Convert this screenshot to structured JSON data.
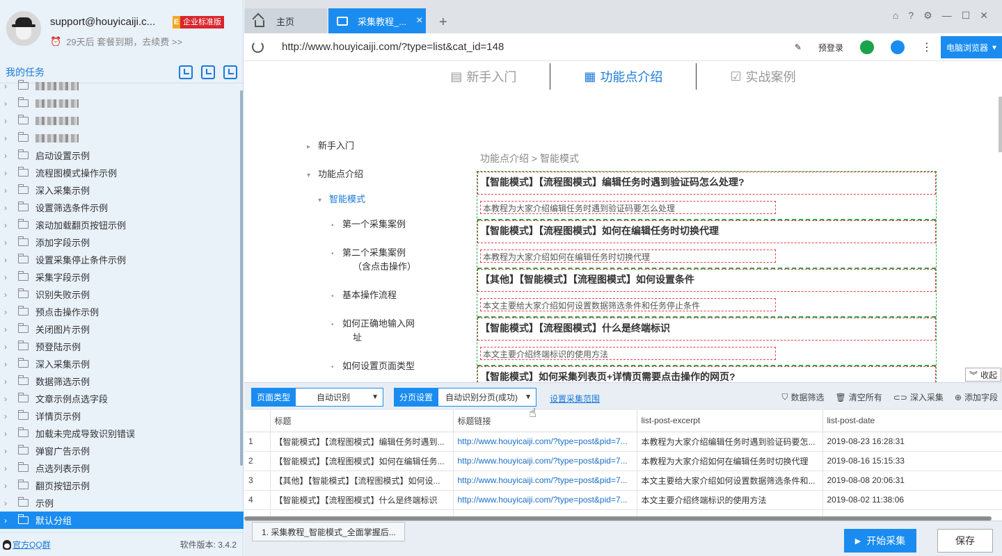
{
  "user": {
    "email": "support@houyicaiji.c...",
    "badge_e": "E",
    "badge_text": "企业标准版",
    "expire_text": "29天后 套餐到期，去续费 >>"
  },
  "sidebar": {
    "title": "我的任务",
    "tools": [
      "import-icon",
      "new-task-icon",
      "search-task-icon"
    ],
    "tree": [
      {
        "label": "",
        "blurred": true
      },
      {
        "label": "",
        "blurred": true
      },
      {
        "label": "",
        "blurred": true
      },
      {
        "label": "",
        "blurred": true
      },
      {
        "label": "启动设置示例"
      },
      {
        "label": "流程图模式操作示例"
      },
      {
        "label": "深入采集示例"
      },
      {
        "label": "设置筛选条件示例"
      },
      {
        "label": "滚动加载翻页按钮示例"
      },
      {
        "label": "添加字段示例"
      },
      {
        "label": "设置采集停止条件示例"
      },
      {
        "label": "采集字段示例"
      },
      {
        "label": "识别失败示例"
      },
      {
        "label": "预点击操作示例"
      },
      {
        "label": "关闭图片示例"
      },
      {
        "label": "预登陆示例"
      },
      {
        "label": "深入采集示例"
      },
      {
        "label": "数据筛选示例"
      },
      {
        "label": "文章示例点选字段"
      },
      {
        "label": "详情页示例"
      },
      {
        "label": "加载未完成导致识别错误"
      },
      {
        "label": "弹窗广告示例"
      },
      {
        "label": "点选列表示例"
      },
      {
        "label": "翻页按钮示例"
      },
      {
        "label": "示例"
      },
      {
        "label": "默认分组",
        "selected": true
      }
    ],
    "footer_link": "官方QQ群",
    "version": "软件版本: 3.4.2"
  },
  "tabs": {
    "home": "主页",
    "active": "采集教程_...",
    "add": "+",
    "close": "×"
  },
  "window_controls": [
    "gift-icon",
    "help-icon",
    "settings-icon",
    "minimize-icon",
    "maximize-icon",
    "close-icon"
  ],
  "window_glyphs": [
    "⌂",
    "?",
    "⚙",
    "—",
    "☐",
    "✕"
  ],
  "address": {
    "url": "http://www.houyicaiji.com/?type=list&cat_id=148",
    "prelogin": "预登录",
    "browser_mode": "电脑浏览器",
    "colors": {
      "green": "#1aa34a",
      "blue": "#1a8cf0"
    }
  },
  "webpage": {
    "nav": [
      "新手入门",
      "功能点介绍",
      "实战案例"
    ],
    "breadcrumb": "功能点介绍 > 智能模式",
    "left_nav": [
      {
        "label": "新手入门",
        "marker": "▸"
      },
      {
        "label": "功能点介绍",
        "marker": "▾"
      },
      {
        "label": "智能模式",
        "marker": "▾"
      },
      {
        "label": "第一个采集案例",
        "marker": "•"
      },
      {
        "label": "第二个采集案例",
        "marker": "•"
      },
      {
        "label": "（含点击操作）",
        "marker": ""
      },
      {
        "label": "基本操作流程",
        "marker": "•"
      },
      {
        "label": "如何正确地输入网",
        "marker": "•"
      },
      {
        "label": "址",
        "marker": ""
      },
      {
        "label": "如何设置页面类型",
        "marker": "•"
      }
    ],
    "posts": [
      {
        "title": "【智能模式】【流程图模式】编辑任务时遇到验证码怎么处理?",
        "excerpt": "本教程为大家介绍编辑任务时遇到验证码要怎么处理"
      },
      {
        "title": "【智能模式】【流程图模式】如何在编辑任务时切换代理",
        "excerpt": "本教程为大家介绍如何在编辑任务时切换代理"
      },
      {
        "title": "【其他】【智能模式】【流程图模式】如何设置条件",
        "excerpt": "本文主要给大家介绍如何设置数据筛选条件和任务停止条件"
      },
      {
        "title": "【智能模式】【流程图模式】什么是终端标识",
        "excerpt": "本文主要介绍终端标识的使用方法"
      },
      {
        "title": "【智能模式】如何采集列表页+详情页需要点击操作的网页?",
        "excerpt": ""
      }
    ],
    "collapse": "收起"
  },
  "toolbar": {
    "page_type_label": "页面类型",
    "page_type_value": "自动识别",
    "paging_label": "分页设置",
    "paging_value": "自动识别分页(成功)",
    "set_range": "设置采集范围",
    "actions": [
      "数据筛选",
      "清空所有",
      "深入采集",
      "添加字段"
    ]
  },
  "table": {
    "columns": [
      "",
      "标题",
      "标题链接",
      "list-post-excerpt",
      "list-post-date"
    ],
    "rows": [
      [
        "1",
        "【智能模式】【流程图模式】编辑任务时遇到...",
        "http://www.houyicaiji.com/?type=post&pid=7...",
        "本教程为大家介绍编辑任务时遇到验证码要怎...",
        "2019-08-23 16:28:31"
      ],
      [
        "2",
        "【智能模式】【流程图模式】如何在编辑任务...",
        "http://www.houyicaiji.com/?type=post&pid=7...",
        "本教程为大家介绍如何在编辑任务时切换代理",
        "2019-08-16 15:15:33"
      ],
      [
        "3",
        "【其他】【智能模式】【流程图模式】如何设...",
        "http://www.houyicaiji.com/?type=post&pid=7...",
        "本文主要给大家介绍如何设置数据筛选条件和...",
        "2019-08-08 20:06:31"
      ],
      [
        "4",
        "【智能模式】【流程图模式】什么是终端标识",
        "http://www.houyicaiji.com/?type=post&pid=7...",
        "本文主要介绍终端标识的使用方法",
        "2019-08-02 11:38:06"
      ]
    ]
  },
  "bottom": {
    "task_chip": "1. 采集教程_智能模式_全面掌握后...",
    "start": "开始采集",
    "save": "保存"
  }
}
